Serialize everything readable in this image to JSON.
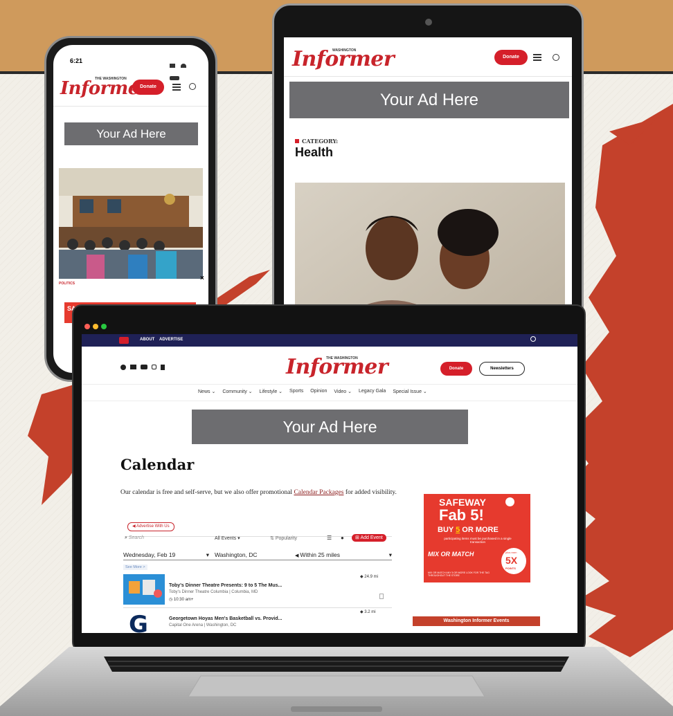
{
  "phone": {
    "time": "6:21",
    "logo_small": "THE WASHINGTON",
    "logo": "Informer",
    "donate": "Donate",
    "ad": "Your Ad Here",
    "section_label": "POLITICS",
    "bottom_ad_text": "SAF"
  },
  "tablet": {
    "logo_small": "WASHINGTON",
    "logo": "Informer",
    "donate": "Donate",
    "ad": "Your Ad Here",
    "category_label": "CATEGORY:",
    "category": "Health"
  },
  "laptop": {
    "topbar": {
      "about": "ABOUT",
      "advertise": "ADVERTISE"
    },
    "logo_small": "THE WASHINGTON",
    "logo": "Informer",
    "donate": "Donate",
    "newsletters": "Newsletters",
    "nav": [
      "News ⌄",
      "Community ⌄",
      "Lifestyle ⌄",
      "Sports",
      "Opinion",
      "Video ⌄",
      "Legacy Gala",
      "Special Issue ⌄"
    ],
    "ad": "Your Ad Here",
    "page_title": "Calendar",
    "intro_before": "Our calendar is free and self-serve, but we also offer promotional ",
    "intro_link": "Calendar Packages",
    "intro_after": " for added visibility.",
    "advertise_with_us": "Advertise With Us",
    "search_placeholder": "Search",
    "all_events": "All Events",
    "popularity": "Popularity",
    "add_event": "Add Event",
    "date": "Wednesday, Feb 19",
    "location": "Washington, DC",
    "radius": "Within 25 miles",
    "see_more": "See More >",
    "events": [
      {
        "title": "Toby's Dinner Theatre Presents: 9 to 5 The Mus...",
        "venue": "Toby's Dinner Theatre Columbia | Columbia, MD",
        "time": "10:30 am+",
        "distance": "24.9 mi"
      },
      {
        "title": "Georgetown Hoyas Men's Basketball vs. Provid...",
        "venue": "Capital One Arena | Washington, DC",
        "time": "",
        "distance": "3.2 mi"
      }
    ],
    "side_ad": {
      "brand": "SAFEWAY",
      "fab": "Fab 5!",
      "buy_before": "BUY ",
      "buy_num": "5",
      "buy_after": " OR MORE",
      "fine": "participating items must be purchased in a single transaction",
      "mix": "MIX OR MATCH",
      "plus": "plus earn",
      "points_num": "5X",
      "points": "POINTS",
      "disclaimer": "MIX OR MATCH ANY 5 OR MORE LOOK FOR THE TAG THROUGHOUT THE STORE"
    },
    "events_box_title": "Washington Informer Events"
  }
}
